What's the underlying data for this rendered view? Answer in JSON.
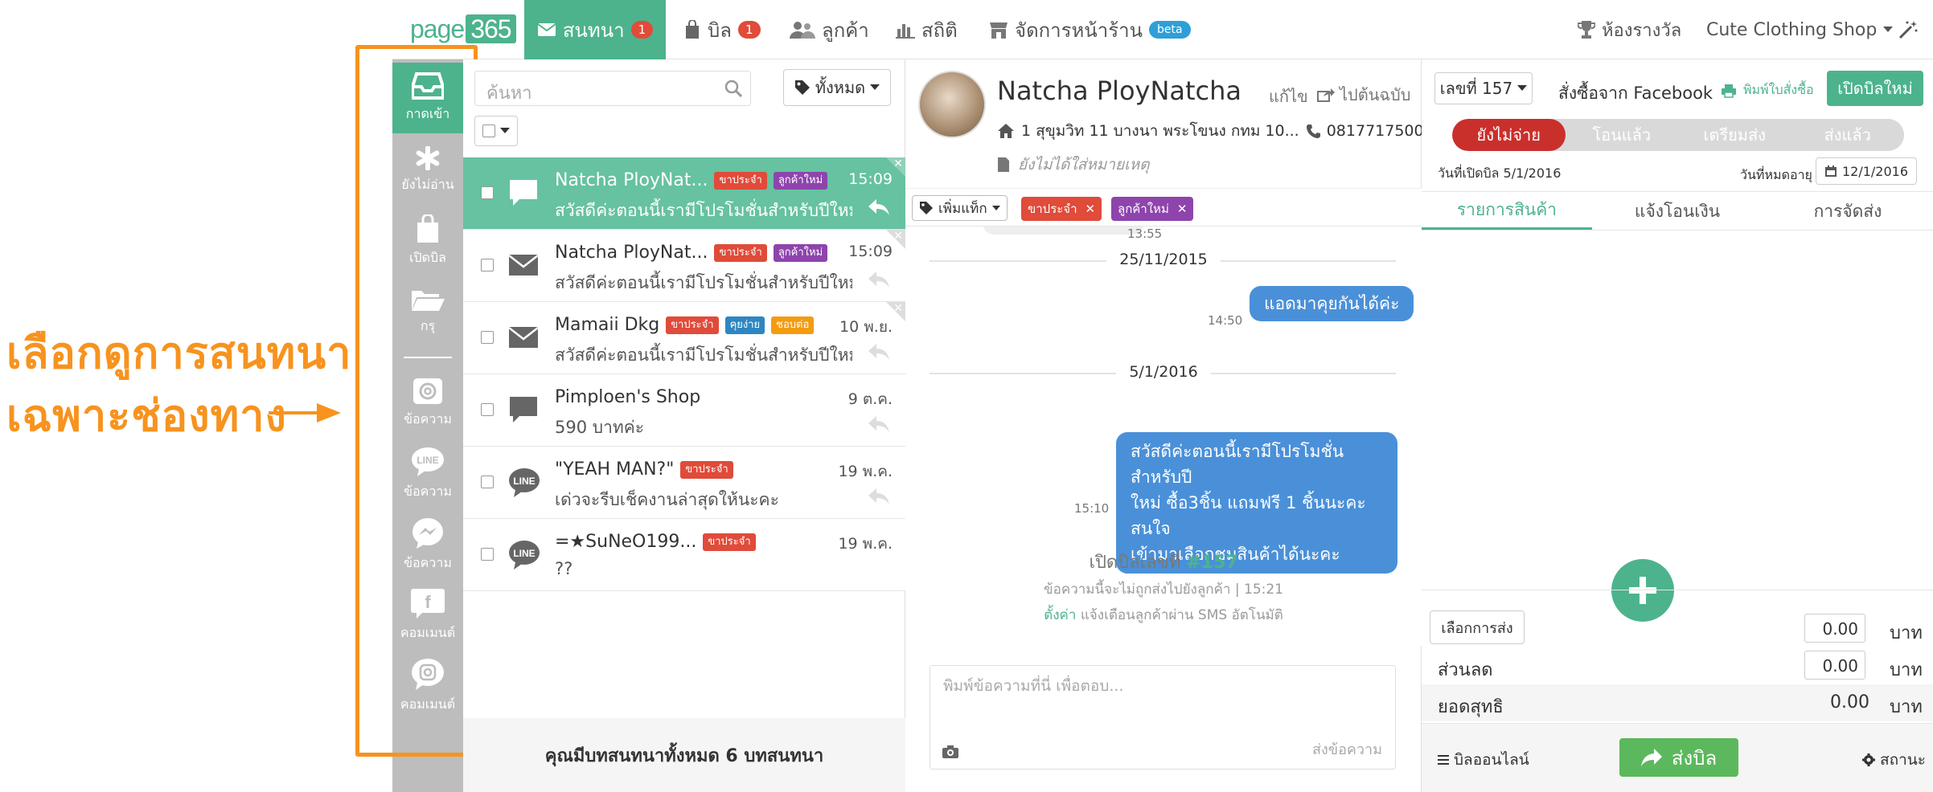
{
  "annotation": {
    "line1": "เลือกดูการสนทนา",
    "line2": "เฉพาะช่องทาง"
  },
  "logo": {
    "text": "page",
    "num": "365"
  },
  "nav": {
    "tabs": [
      {
        "label": "สนทนา",
        "badge": "1",
        "icon": "envelope-icon"
      },
      {
        "label": "บิล",
        "badge": "1",
        "icon": "bag-icon"
      },
      {
        "label": "ลูกค้า",
        "icon": "users-icon"
      },
      {
        "label": "สถิติ",
        "icon": "bar-chart-icon"
      },
      {
        "label": "จัดการหน้าร้าน",
        "badge": "beta",
        "icon": "store-icon"
      }
    ],
    "awards": "ห้องรางวัล",
    "shop": "Cute Clothing Shop"
  },
  "sidebar": {
    "items": [
      {
        "label": "กาดเข้า",
        "icon": "inbox-icon"
      },
      {
        "label": "ยังไม่อ่าน",
        "icon": "asterisk-icon"
      },
      {
        "label": "เปิดบิล",
        "icon": "bag-icon"
      },
      {
        "label": "กรุ",
        "icon": "folder-icon"
      },
      {
        "label": "ข้อความ",
        "icon": "at-icon"
      },
      {
        "label": "ข้อความ",
        "icon": "line-icon"
      },
      {
        "label": "ข้อความ",
        "icon": "messenger-icon"
      },
      {
        "label": "คอมเมนต์",
        "icon": "facebook-icon"
      },
      {
        "label": "คอมเมนต์",
        "icon": "instagram-icon"
      }
    ]
  },
  "list": {
    "search_placeholder": "ค้นหา",
    "tag_filter": "ทั้งหมด",
    "footer": "คุณมีบทสนทนาทั้งหมด 6 บทสนทนา",
    "conversations": [
      {
        "name": "Natcha PloyNat...",
        "tags": [
          "ขาประจำ",
          "ลูกค้าใหม่"
        ],
        "preview": "สวัสดีค่ะตอนนี้เรามีโปรโมชั่นสำหรับปีใหม่ ซื้อ...",
        "time": "15:09",
        "channel": "chat-bubble-icon"
      },
      {
        "name": "Natcha PloyNat...",
        "tags": [
          "ขาประจำ",
          "ลูกค้าใหม่"
        ],
        "preview": "สวัสดีค่ะตอนนี้เรามีโปรโมชั่นสำหรับปีใหม่ ซื้อ...",
        "time": "15:09",
        "channel": "envelope-icon"
      },
      {
        "name": "Mamaii Dkg",
        "tags": [
          "ขาประจำ",
          "คุยง่าย",
          "ชอบต่อ"
        ],
        "preview": "สวัสดีค่ะตอนนี้เรามีโปรโมชั่นสำหรับปีใหม่ ซื้อ...",
        "time": "10 พ.ย.",
        "channel": "envelope-icon"
      },
      {
        "name": "Pimploen's Shop",
        "tags": [],
        "preview": "590 บาทค่ะ",
        "time": "9 ต.ค.",
        "channel": "chat-bubble-icon"
      },
      {
        "name": "\"YEAH MAN?\"",
        "tags": [
          "ขาประจำ"
        ],
        "preview": "เด่วจะรีบเช็คงานล่าสุดให้นะคะ",
        "time": "19 พ.ค.",
        "channel": "line-icon"
      },
      {
        "name": "=★SuNeO199...",
        "tags": [
          "ขาประจำ"
        ],
        "preview": "??",
        "time": "19 พ.ค.",
        "channel": "line-icon"
      }
    ]
  },
  "chat": {
    "name": "Natcha PloyNatcha",
    "edit": "แก้ไข",
    "forward": "ไปต้นฉบับ",
    "address": "1 สุขุมวิท 11 บางนา พระโขนง กทม 10...",
    "phone": "0817717500",
    "note": "ยังไม่ได้ใส่หมายเหตุ",
    "add_tag": "เพิ่มแท็ก",
    "tags": [
      "ขาประจำ",
      "ลูกค้าใหม่"
    ],
    "partial_time": "13:55",
    "messages": [
      {
        "date": "25/11/2015",
        "text": "แอดมาคุยกันได้ค่ะ",
        "time": "14:50"
      },
      {
        "date": "5/1/2016",
        "text1": "สวัสดีค่ะตอนนี้เรามีโปรโมชั่นสำหรับปี",
        "text2": "ใหม่ ซื้อ3ชิ้น แถมฟรี 1 ชิ้นนะคะ สนใจ",
        "text3": "เข้ามาเลือกชมสินค้าได้นะคะ",
        "time": "15:10"
      }
    ],
    "system": {
      "title": "เปิดบิลเลขที่",
      "bill_no": "#157",
      "sub": "ข้อความนี้จะไม่ถูกส่งไปยังลูกค้า | 15:21",
      "setting_link": "ตั้งค่า",
      "setting_text": "แจ้งเตือนลูกค้าผ่าน SMS อัตโนมัติ"
    },
    "composer_placeholder": "พิมพ์ข้อความที่นี่ เพื่อตอบ...",
    "send": "ส่งข้อความ"
  },
  "order": {
    "bill_no": "เลขที่ 157",
    "source": "สั่งซื้อจาก Facebook",
    "print": "พิมพ์ใบสั่งซื้อ",
    "open_new": "เปิดบิลใหม่",
    "status": [
      "ยังไม่จ่าย",
      "โอนแล้ว",
      "เตรียมส่ง",
      "ส่งแล้ว"
    ],
    "open_date": "วันที่เปิดบิล 5/1/2016",
    "expire_label": "วันที่หมดอายุ",
    "expire_date": "12/1/2016",
    "tabs": [
      "รายการสินค้า",
      "แจ้งโอนเงิน",
      "การจัดส่ง"
    ],
    "shipping_btn": "เลือกการส่ง",
    "shipping_val": "0.00",
    "discount_label": "ส่วนลด",
    "discount_val": "0.00",
    "net_label": "ยอดสุทธิ",
    "net_val": "0.00",
    "currency": "บาท",
    "online_bill": "บิลออนไลน์",
    "send_bill": "ส่งบิล",
    "status_label": "สถานะ"
  },
  "colors": {
    "brand": "#4db38d",
    "accent": "#f7931e",
    "badge": "#e04b3a",
    "bubble": "#4a90d9",
    "unpaid": "#c9302c"
  }
}
